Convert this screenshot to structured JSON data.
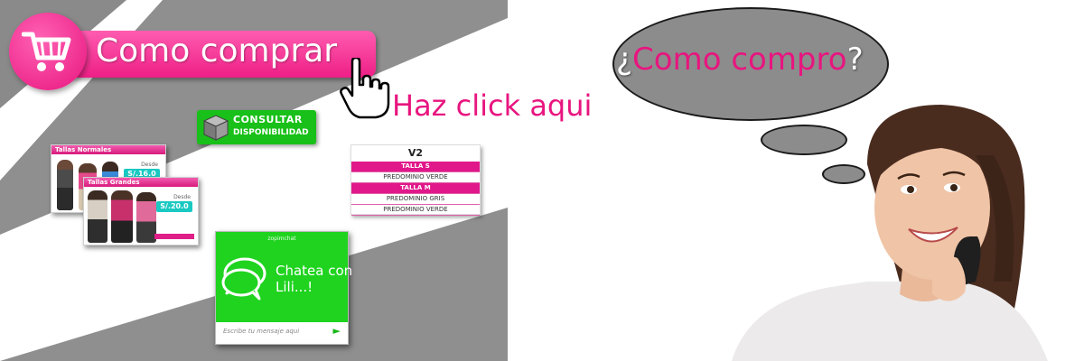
{
  "buy_button": {
    "label": "Como comprar",
    "icon": "shopping-cart-icon"
  },
  "click_hint": {
    "label": "Haz click aqui",
    "icon": "hand-pointer-icon"
  },
  "consult_button": {
    "line1": "CONSULTAR",
    "line2": "DISPONIBILIDAD",
    "icon": "box-icon"
  },
  "size_cards": [
    {
      "title": "Tallas Normales",
      "desde": "Desde",
      "price": "S/.16.0"
    },
    {
      "title": "Tallas Grandes",
      "desde": "Desde",
      "price": "S/.20.0"
    }
  ],
  "size_table": {
    "title": "V2",
    "rows": [
      {
        "text": "TALLA S",
        "highlight": true
      },
      {
        "text": "PREDOMINIO VERDE",
        "highlight": false
      },
      {
        "text": "TALLA M",
        "highlight": true
      },
      {
        "text": "PREDOMINIO GRIS",
        "highlight": false
      },
      {
        "text": "PREDOMINIO VERDE",
        "highlight": false
      }
    ]
  },
  "chat": {
    "brand": "zopimchat",
    "title_line1": "Chatea con",
    "title_line2": "Lili...!",
    "placeholder": "Escribe tu mensaje aqui",
    "send_icon": "send-arrow-icon"
  },
  "thought": {
    "open_q": "¿",
    "text": "Como compro",
    "close_q": "?"
  },
  "colors": {
    "pink": "#e8157f",
    "green": "#1fd31f",
    "grey": "#8c8c8c",
    "teal": "#19c9c2"
  }
}
